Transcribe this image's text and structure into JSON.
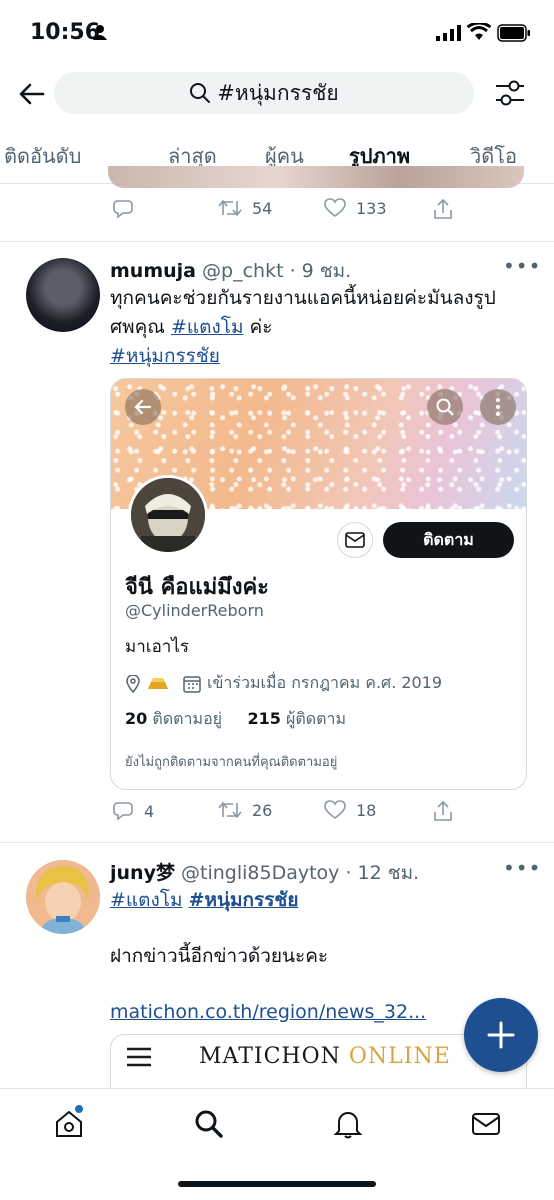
{
  "status_bar": {
    "time": "10:56"
  },
  "search": {
    "query": "#หนุ่มกรรชัย"
  },
  "tabs": [
    {
      "label": "ติดอันดับ"
    },
    {
      "label": "ล่าสุด"
    },
    {
      "label": "ผู้คน"
    },
    {
      "label": "รูปภาพ",
      "active": true
    },
    {
      "label": "วิดีโอ"
    }
  ],
  "post0": {
    "retweets": "54",
    "likes": "133"
  },
  "post1": {
    "display_name": "mumuja",
    "handle_time": "@p_chkt · 9 ชม.",
    "text_line1": "ทุกคนคะช่วยกันรายงานแอคนี้หน่อยค่ะมันลงรูป",
    "text_line2_pre": "ศพคุณ ",
    "tag1": "#แตงโม",
    "text_line2_post": " ค่ะ",
    "tag2": "#หนุ่มกรรชัย",
    "replies": "4",
    "retweets": "26",
    "likes": "18",
    "profile_card": {
      "name": "จีนี คือแม่มึงค่ะ",
      "handle": "@CylinderReborn",
      "follow_label": "ติดตาม",
      "bio": "มาเอาไร",
      "joined": "เข้าร่วมเมื่อ กรกฎาคม ค.ศ. 2019",
      "following_count": "20",
      "following_label": "ติดตามอยู่",
      "followers_count": "215",
      "followers_label": "ผู้ติดตาม",
      "note": "ยังไม่ถูกติดตามจากคนที่คุณติดตามอยู่"
    }
  },
  "post2": {
    "display_name": "juny梦",
    "handle_time": "@tingli85Daytoy · 12 ชม.",
    "tag1": "#แตงโม",
    "tag2": "#หนุ่มกรรชัย",
    "text": "ฝากข่าวนี้อีกข่าวด้วยนะคะ",
    "link": "matichon.co.th/region/news_32...",
    "link_card": {
      "brand_part1": "MATICHON",
      "brand_part2": "ONLINE"
    }
  },
  "colors": {
    "accent": "#1d6fb8",
    "link": "#1d4f91",
    "fab": "#1d4f91"
  },
  "icons": [
    "back-arrow-icon",
    "search-icon",
    "filter-icon",
    "reply-icon",
    "retweet-icon",
    "like-icon",
    "share-icon",
    "home-icon",
    "explore-icon",
    "notifications-icon",
    "messages-icon",
    "compose-icon"
  ]
}
